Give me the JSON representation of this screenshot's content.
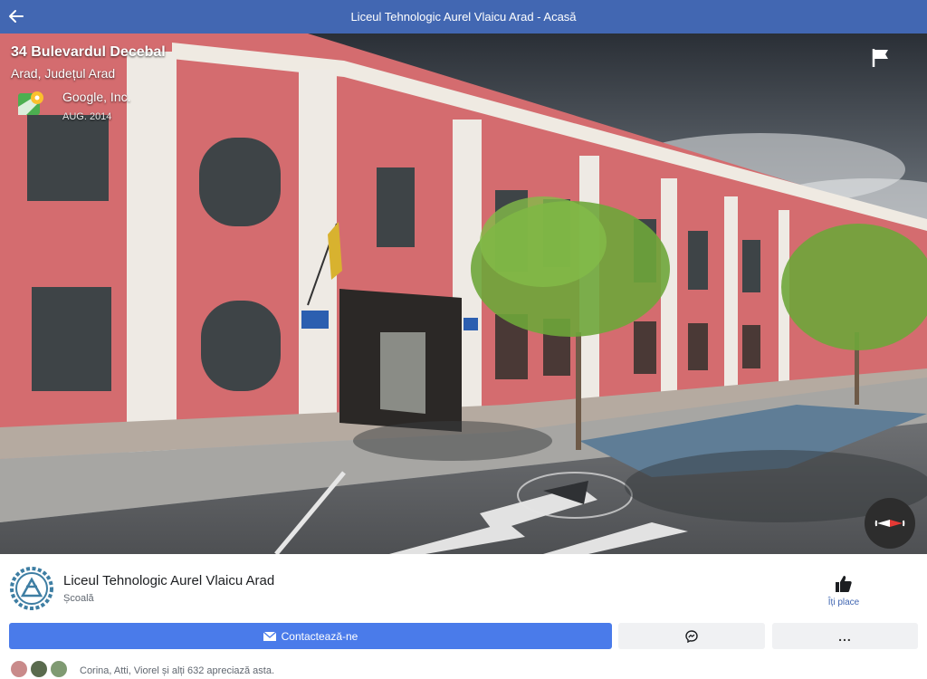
{
  "header": {
    "title": "Liceul Tehnologic Aurel Vlaicu Arad - Acasă"
  },
  "streetview": {
    "address_line1": "34 Bulevardul Decebal",
    "address_line2": "Arad, Județul Arad",
    "provider": "Google, Inc.",
    "date": "AUG. 2014"
  },
  "page": {
    "name": "Liceul Tehnologic Aurel Vlaicu Arad",
    "category": "Școală",
    "like_label": "Îți place",
    "contact_label": "Contactează-ne",
    "more_label": "...",
    "friends_text": "Corina, Atti, Viorel și alți 632 apreciază asta."
  },
  "icons": {
    "back": "arrow-left-icon",
    "flag": "flag-icon",
    "compass": "compass-icon",
    "like": "thumbs-up-icon",
    "contact": "envelope-icon",
    "messenger": "messenger-icon"
  },
  "colors": {
    "header_bg": "#4267b2",
    "contact_button": "#4a7bea",
    "secondary_button": "#f0f1f3",
    "link": "#4267b2"
  }
}
